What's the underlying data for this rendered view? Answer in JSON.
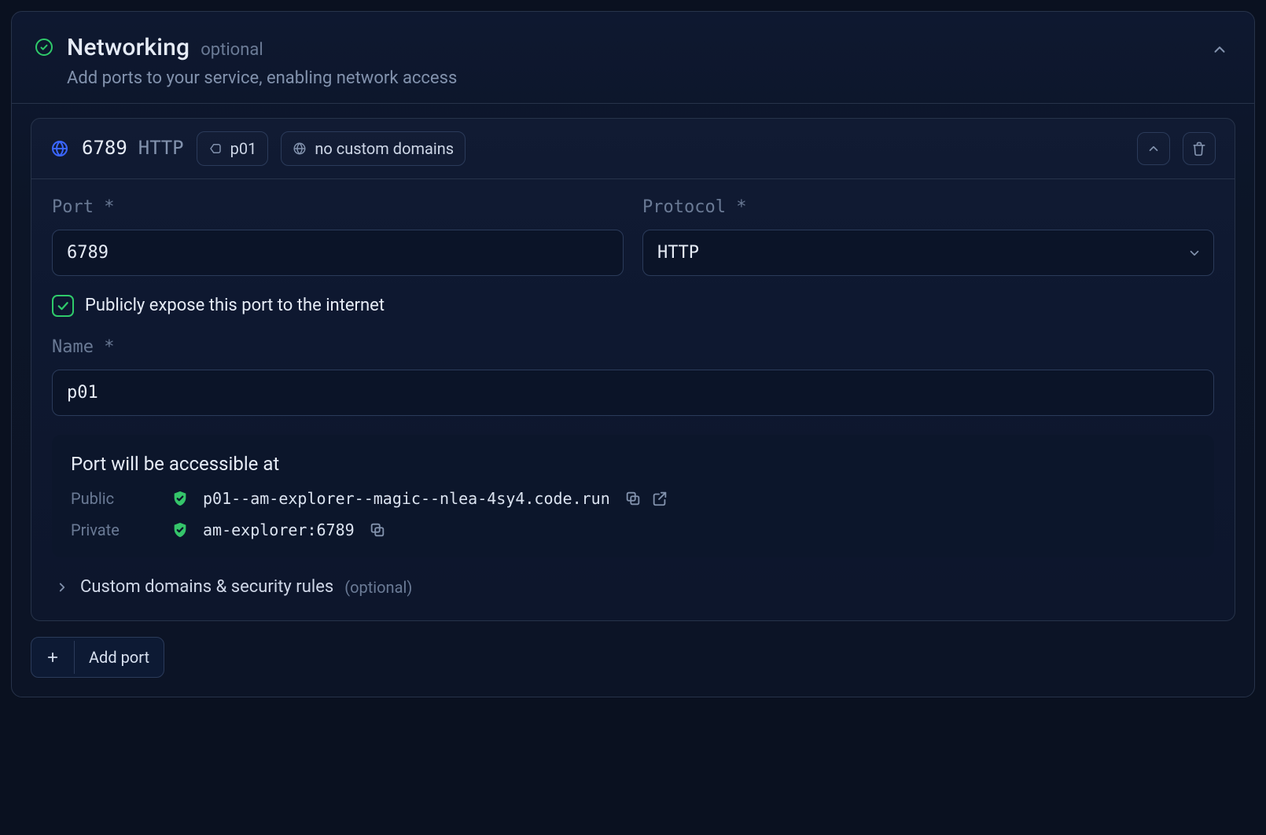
{
  "header": {
    "title": "Networking",
    "optional": "optional",
    "subtitle": "Add ports to your service, enabling network access"
  },
  "port": {
    "port_number": "6789",
    "protocol_short": "HTTP",
    "name_tag": "p01",
    "domains_tag": "no custom domains"
  },
  "form": {
    "port_label": "Port *",
    "protocol_label": "Protocol *",
    "port_value": "6789",
    "protocol_value": "HTTP",
    "expose_label": "Publicly expose this port to the internet",
    "name_label": "Name *",
    "name_value": "p01"
  },
  "access": {
    "title": "Port will be accessible at",
    "public_label": "Public",
    "private_label": "Private",
    "public_url": "p01--am-explorer--magic--nlea-4sy4.code.run",
    "private_url": "am-explorer:6789"
  },
  "custom_domains": {
    "label": "Custom domains & security rules",
    "optional": "(optional)"
  },
  "buttons": {
    "add_port": "Add port"
  }
}
